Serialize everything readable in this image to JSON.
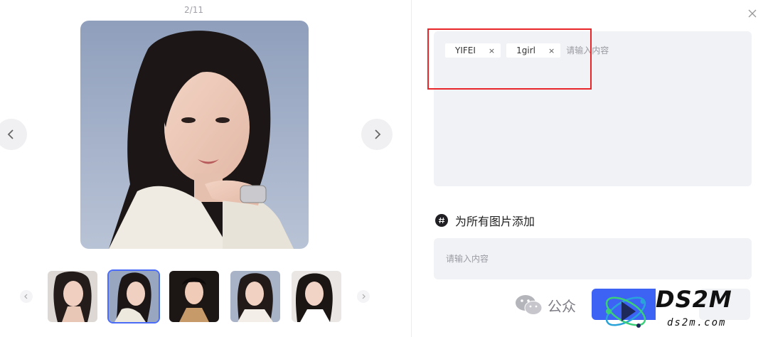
{
  "viewer": {
    "counter": "2/11",
    "thumbnails": [
      {
        "label": "portrait-1",
        "active": false
      },
      {
        "label": "portrait-2",
        "active": true
      },
      {
        "label": "portrait-3",
        "active": false
      },
      {
        "label": "portrait-4",
        "active": false
      },
      {
        "label": "portrait-5",
        "active": false
      }
    ]
  },
  "panel": {
    "tags": [
      {
        "text": "YIFEI",
        "remove": "×"
      },
      {
        "text": "1girl",
        "remove": "×"
      }
    ],
    "tag_placeholder": "请输入内容",
    "section_title": "为所有图片添加",
    "all_placeholder": "请输入内容"
  },
  "watermark": {
    "wechat_text": "公众",
    "brand": "DS2M",
    "domain": "ds2m.com"
  },
  "colors": {
    "accent": "#3d63f5",
    "highlight": "#e8262a",
    "input_bg": "#f1f2f6"
  }
}
